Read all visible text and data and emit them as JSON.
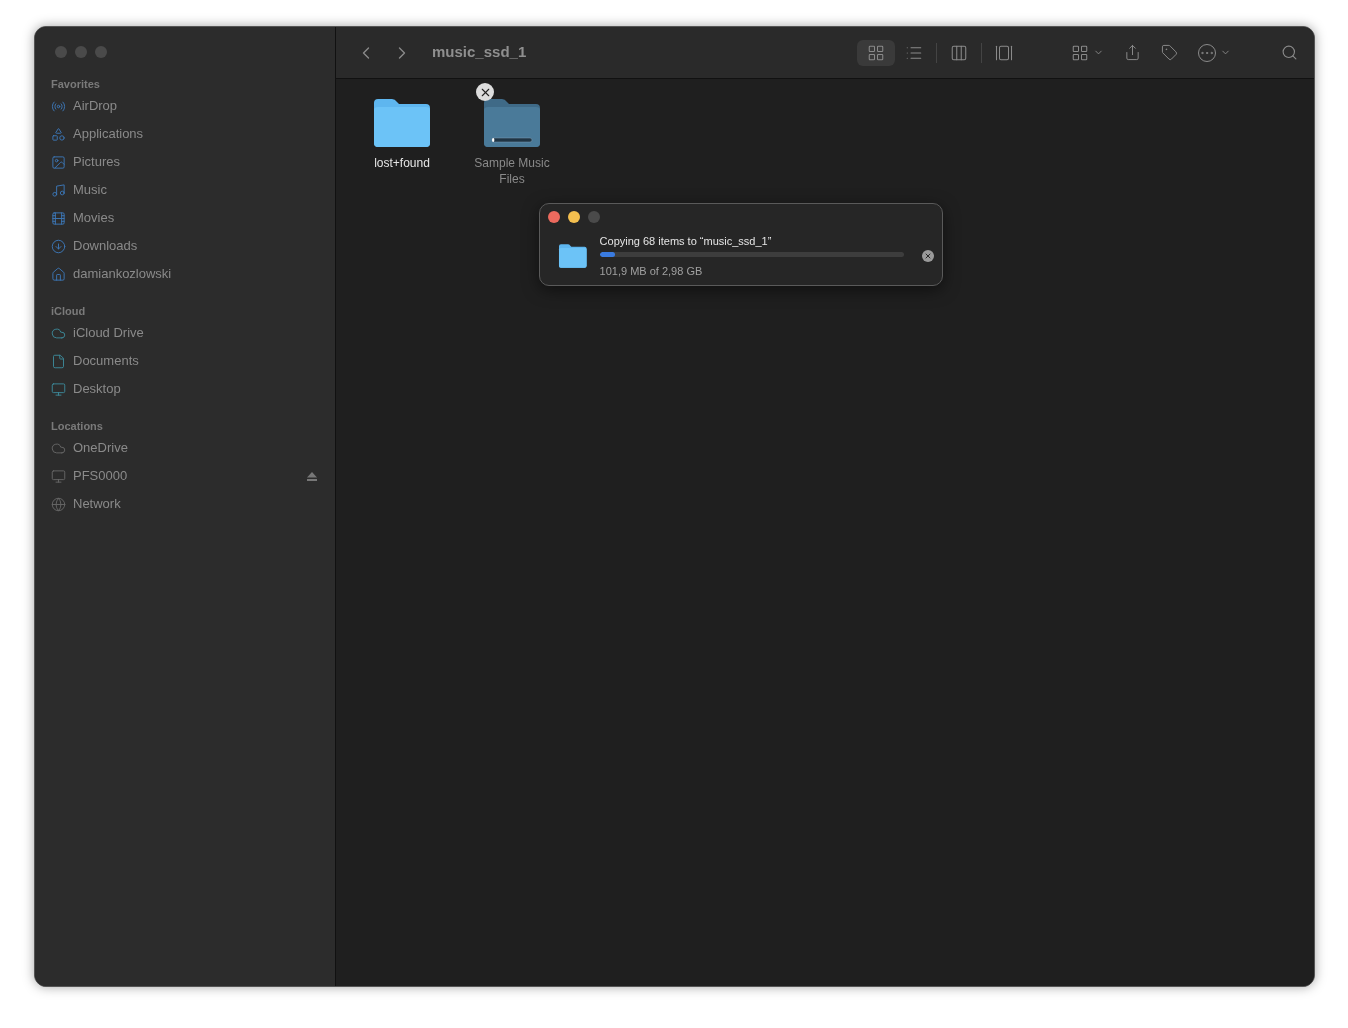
{
  "window": {
    "title": "music_ssd_1"
  },
  "sidebar": {
    "sections": [
      {
        "title": "Favorites",
        "items": [
          {
            "label": "AirDrop"
          },
          {
            "label": "Applications"
          },
          {
            "label": "Pictures"
          },
          {
            "label": "Music"
          },
          {
            "label": "Movies"
          },
          {
            "label": "Downloads"
          },
          {
            "label": "damiankozlowski"
          }
        ]
      },
      {
        "title": "iCloud",
        "items": [
          {
            "label": "iCloud Drive"
          },
          {
            "label": "Documents"
          },
          {
            "label": "Desktop"
          }
        ]
      },
      {
        "title": "Locations",
        "items": [
          {
            "label": "OneDrive",
            "ejectable": false
          },
          {
            "label": "PFS0000",
            "ejectable": true
          },
          {
            "label": "Network",
            "ejectable": false
          }
        ]
      }
    ]
  },
  "toolbar": {
    "views": [
      {
        "kind": "icons",
        "selected": true
      },
      {
        "kind": "list",
        "selected": false
      },
      {
        "kind": "columns",
        "selected": false
      },
      {
        "kind": "gallery",
        "selected": false
      }
    ]
  },
  "files": [
    {
      "name": "lost+found",
      "kind": "folder"
    },
    {
      "name": "Sample Music Files",
      "kind": "copying",
      "level": 0.06
    }
  ],
  "copy_dialog": {
    "message": "Copying 68 items to “music_ssd_1”",
    "progress": "101,9 MB of 2,98 GB",
    "level": 0.05
  }
}
